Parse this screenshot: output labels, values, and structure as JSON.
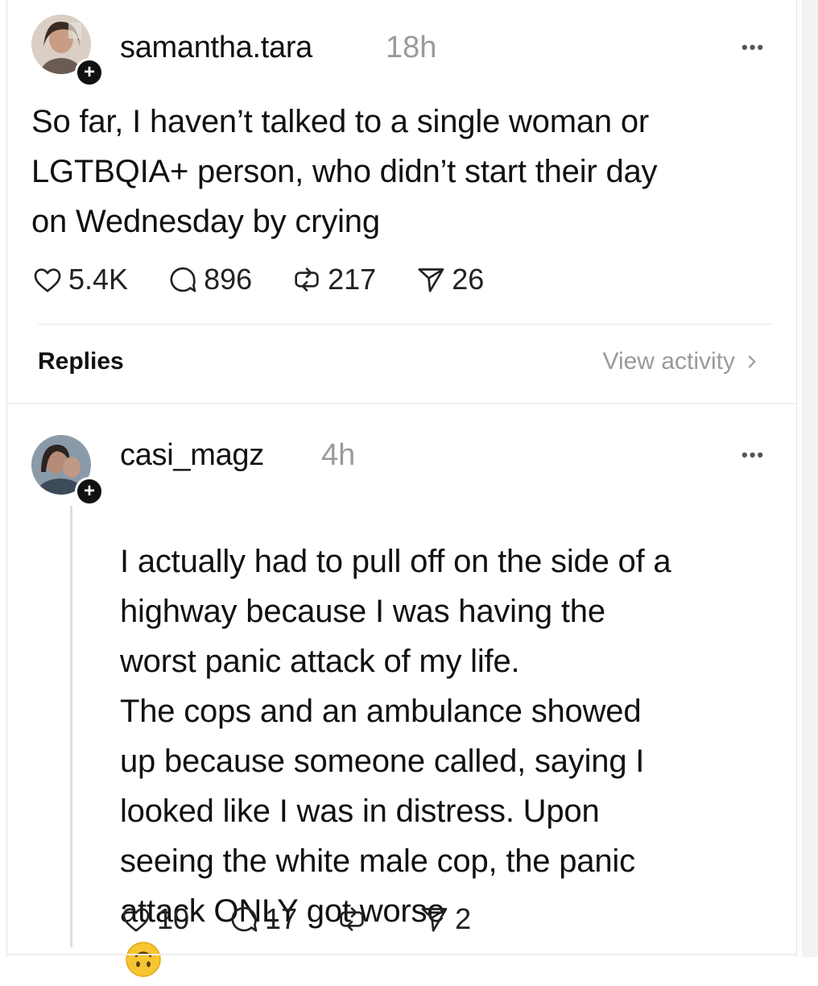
{
  "post": {
    "username": "samantha.tara",
    "time": "18h",
    "body": "So far, I haven’t talked to a single woman or\nLGTBQIA+ person, who didn’t start their day\non Wednesday by crying",
    "likes": "5.4K",
    "comments": "896",
    "reposts": "217",
    "shares": "26"
  },
  "replies_section": {
    "label": "Replies",
    "view_activity": "View activity"
  },
  "reply": {
    "username": "casi_magz",
    "time": "4h",
    "body": "I actually had to pull off on the side of a\nhighway because I was having the\nworst panic attack of my life.\nThe cops and an ambulance showed\nup because someone called, saying I\nlooked like I was in distress.  Upon\nseeing the white male cop, the panic\nattack ONLY got worse",
    "likes": "10",
    "comments": "17",
    "shares": "2"
  },
  "icons": {
    "heart": "heart-icon",
    "comment": "comment-icon",
    "repost": "repost-icon",
    "share": "share-icon",
    "more": "more-icon",
    "chevron": "chevron-right-icon",
    "emoji": "upside-down-face-emoji"
  },
  "colors": {
    "text": "#111111",
    "muted": "#9a9a9a",
    "emoji": "#f7c531"
  }
}
